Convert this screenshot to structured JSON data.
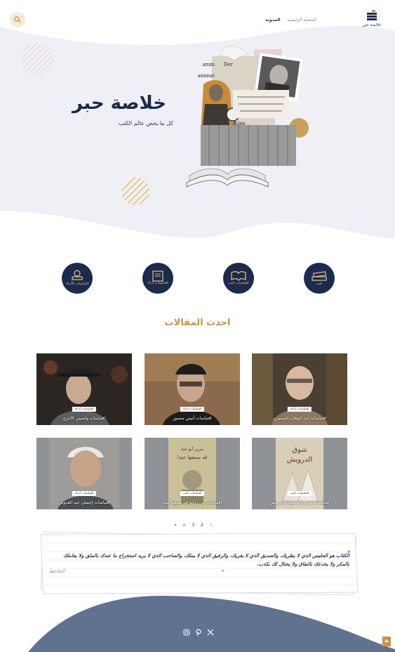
{
  "header": {
    "logo_text": "خلاصة حبر",
    "nav": [
      {
        "label": "الصفحة الرئيسية",
        "active": false
      },
      {
        "label": "المدونة",
        "active": true
      }
    ]
  },
  "hero": {
    "title": "خلاصة حبر",
    "subtitle": "كل ما يخص عالم الكتب"
  },
  "categories": [
    {
      "label": "كتب",
      "icon": "book-stack-icon"
    },
    {
      "label": "اقتباسات كتب",
      "icon": "open-book-icon"
    },
    {
      "label": "اقتباسات أدباء",
      "icon": "quote-book-icon"
    },
    {
      "label": "اقتباسات الأدباء",
      "icon": "apple-books-icon"
    }
  ],
  "section_title": "احدث المقالات",
  "articles": [
    {
      "badge": "اقتباسات ادباء",
      "title": "اقتباسات عبد الوهاب المسيري"
    },
    {
      "badge": "اقتباسات ادباء",
      "title": "اقتباسات أنيس منصور"
    },
    {
      "badge": "اقتباسات ادباء",
      "title": "اقتباسات واسيني الأعرج"
    },
    {
      "badge": "اقتباسات كتب",
      "title": "اقتباسات من رواية شوق الدرويش"
    },
    {
      "badge": "اقتباسات كتب",
      "title": "اقتباسات من رواية قد سمعها جيدا"
    },
    {
      "badge": "اقتباسات ادباء",
      "title": "اقتباسات إحسان عبد القدوس"
    }
  ],
  "pagination": [
    "1",
    "2",
    "3",
    "»",
    "«"
  ],
  "quote": {
    "text": "الكتاب هو الجليس الذي لا يطريك، والصديق الذي لا يغريك، والرفيق الذي لا يملك، والصاحب الذي لا يريد استخراج ما عندك بالملق ولا يعاملك بالمكر ولا يخدعك بالنفاق ولا يحتال لك بكذب.",
    "author": "الجاحظ"
  },
  "colors": {
    "navy": "#1b2b4d",
    "gold": "#c7943e",
    "hero_bg": "#eef0f5",
    "footer_blue": "#5f7390"
  }
}
